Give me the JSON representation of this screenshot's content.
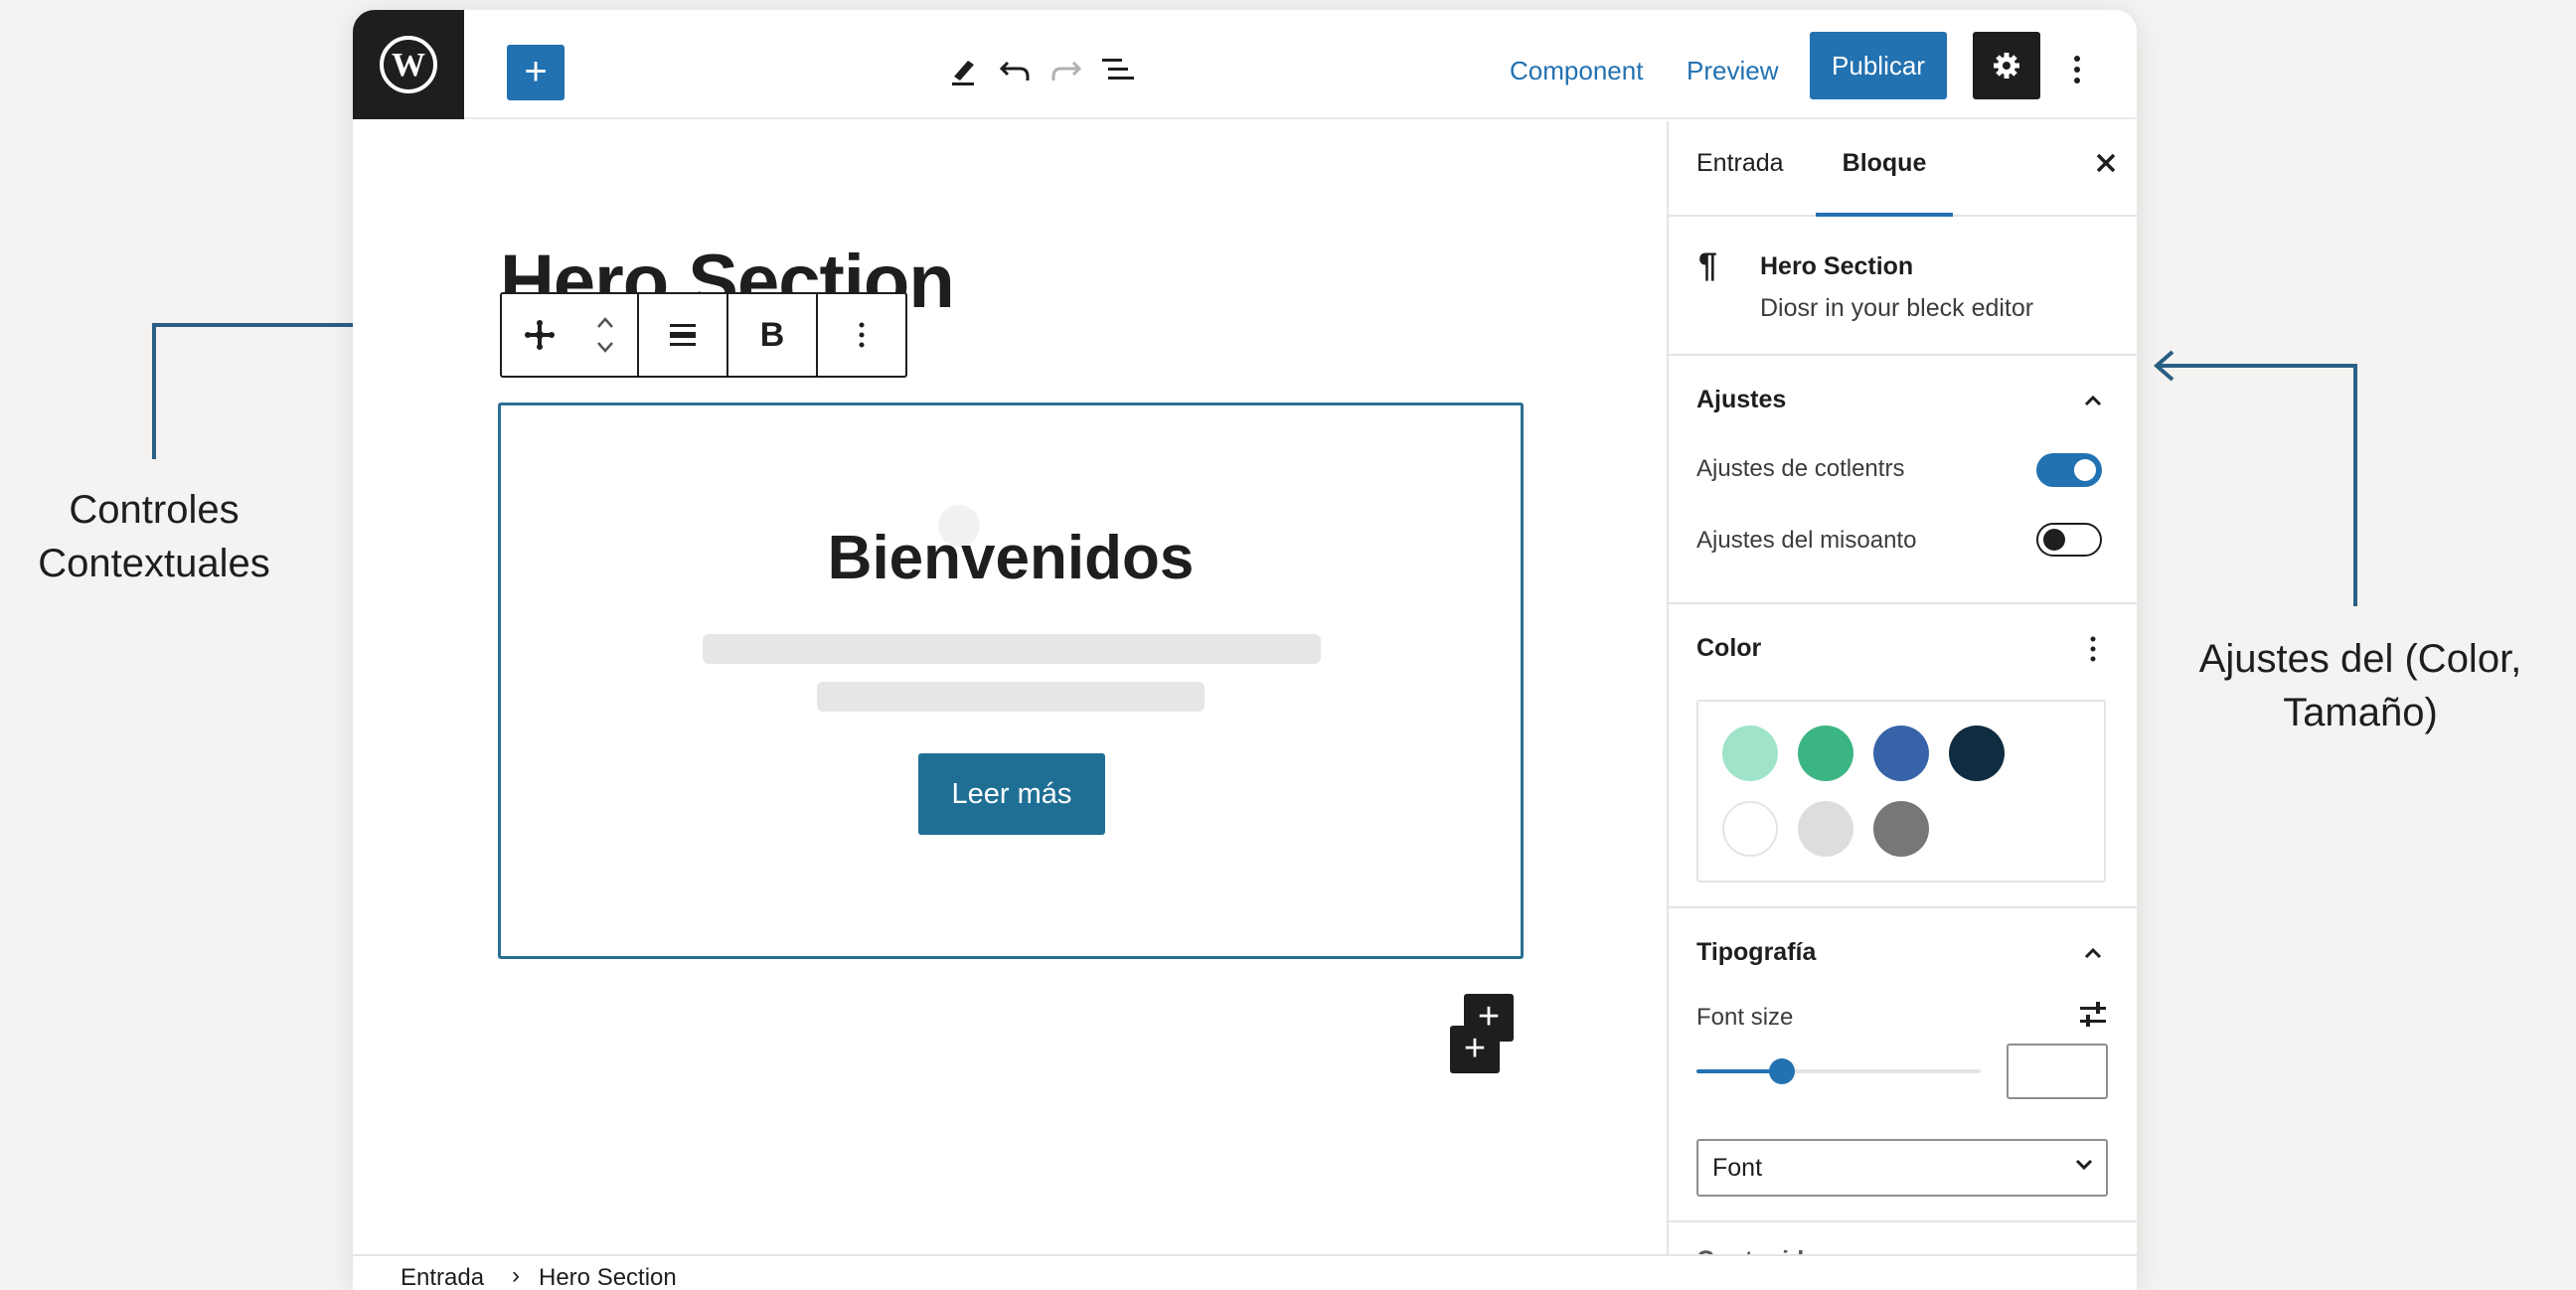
{
  "toolbar": {
    "add_label": "+",
    "component_label": "Component",
    "preview_label": "Preview",
    "publish_label": "Publicar"
  },
  "canvas": {
    "post_title": "Hero Section",
    "hero_heading": "Bienvenidos",
    "hero_button": "Leer más",
    "block_toolbar": {
      "bold_label": "B"
    },
    "inserter_label": "+"
  },
  "sidebar": {
    "tabs": [
      {
        "label": "Entrada",
        "active": false
      },
      {
        "label": "Bloque",
        "active": true
      }
    ],
    "block_card": {
      "icon": "paragraph-icon",
      "title": "Hero Section",
      "description": "Diosr in your bleck editor"
    },
    "ajustes": {
      "title": "Ajustes",
      "toggles": [
        {
          "label": "Ajustes de cotlentrs",
          "on": true
        },
        {
          "label": "Ajustes del misoanto",
          "on": false
        }
      ]
    },
    "color": {
      "title": "Color",
      "swatches": [
        "#9fe3c9",
        "#3bb583",
        "#3764a8",
        "#0f2c40",
        "#ffffff",
        "#dddddd",
        "#777777"
      ]
    },
    "typography": {
      "title": "Tipografía",
      "font_size_label": "Font size",
      "font_size_slider": 0.3,
      "font_select_value": "Font"
    },
    "next_panel_label": "Contenido"
  },
  "footer": {
    "breadcrumb": [
      "Entrada",
      "Hero Section"
    ]
  },
  "annotations": {
    "left": "Controles Contextuales",
    "left_line1": "Controles",
    "left_line2": "Contextuales",
    "right_line1": "Ajustes del (Color,",
    "right_line2": "Tamaño)"
  },
  "colors": {
    "accent": "#2271b1",
    "dark": "#1e1e1e",
    "hero_border": "#2a6f93",
    "annotation_line": "#2a5f85"
  }
}
